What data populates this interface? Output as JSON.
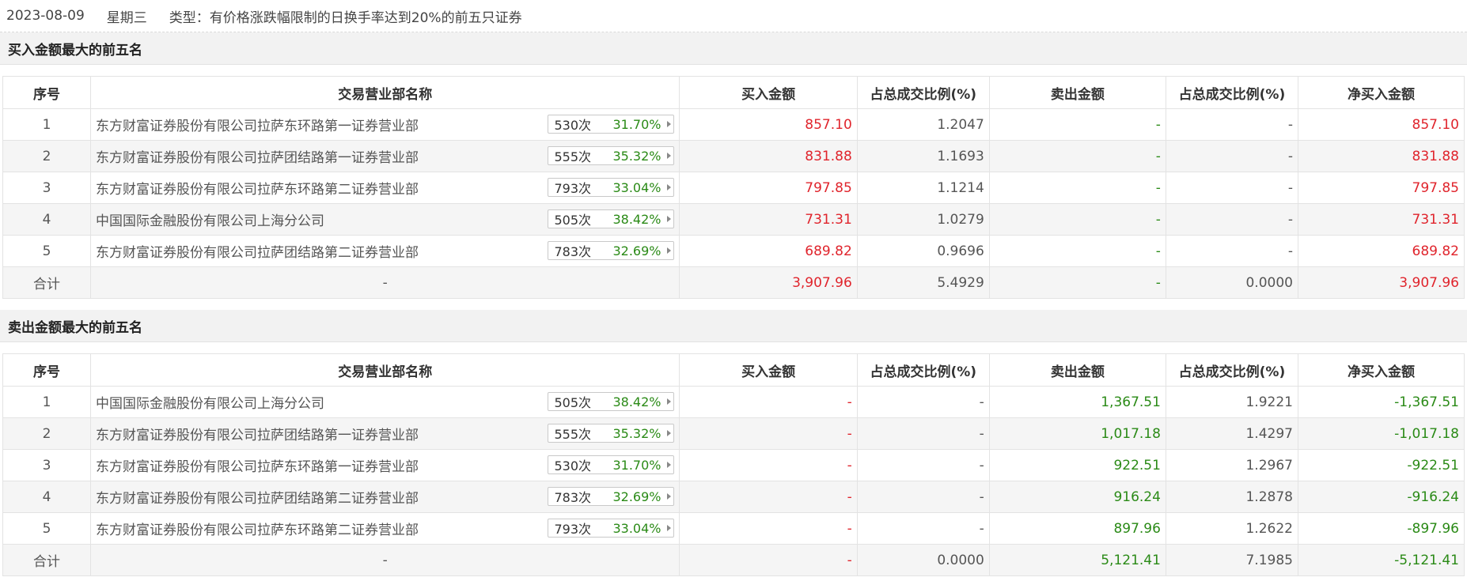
{
  "header": {
    "date": "2023-08-09",
    "weekday": "星期三",
    "type_label": "类型：有价格涨跌幅限制的日换手率达到20%的前五只证券"
  },
  "columns": [
    "序号",
    "交易营业部名称",
    "买入金额",
    "占总成交比例(%)",
    "卖出金额",
    "占总成交比例(%)",
    "净买入金额"
  ],
  "buy_section": {
    "title": "买入金额最大的前五名",
    "rows": [
      {
        "idx": "1",
        "name": "东方财富证券股份有限公司拉萨东环路第一证券营业部",
        "times": "530次",
        "pct": "31.70%",
        "buy": "857.10",
        "buy_ratio": "1.2047",
        "sell": "-",
        "sell_ratio": "-",
        "net": "857.10"
      },
      {
        "idx": "2",
        "name": "东方财富证券股份有限公司拉萨团结路第一证券营业部",
        "times": "555次",
        "pct": "35.32%",
        "buy": "831.88",
        "buy_ratio": "1.1693",
        "sell": "-",
        "sell_ratio": "-",
        "net": "831.88"
      },
      {
        "idx": "3",
        "name": "东方财富证券股份有限公司拉萨东环路第二证券营业部",
        "times": "793次",
        "pct": "33.04%",
        "buy": "797.85",
        "buy_ratio": "1.1214",
        "sell": "-",
        "sell_ratio": "-",
        "net": "797.85"
      },
      {
        "idx": "4",
        "name": "中国国际金融股份有限公司上海分公司",
        "times": "505次",
        "pct": "38.42%",
        "buy": "731.31",
        "buy_ratio": "1.0279",
        "sell": "-",
        "sell_ratio": "-",
        "net": "731.31"
      },
      {
        "idx": "5",
        "name": "东方财富证券股份有限公司拉萨团结路第二证券营业部",
        "times": "783次",
        "pct": "32.69%",
        "buy": "689.82",
        "buy_ratio": "0.9696",
        "sell": "-",
        "sell_ratio": "-",
        "net": "689.82"
      }
    ],
    "total": {
      "label": "合计",
      "name": "-",
      "buy": "3,907.96",
      "buy_ratio": "5.4929",
      "sell": "-",
      "sell_ratio": "0.0000",
      "net": "3,907.96"
    }
  },
  "sell_section": {
    "title": "卖出金额最大的前五名",
    "rows": [
      {
        "idx": "1",
        "name": "中国国际金融股份有限公司上海分公司",
        "times": "505次",
        "pct": "38.42%",
        "buy": "-",
        "buy_ratio": "-",
        "sell": "1,367.51",
        "sell_ratio": "1.9221",
        "net": "-1,367.51"
      },
      {
        "idx": "2",
        "name": "东方财富证券股份有限公司拉萨团结路第一证券营业部",
        "times": "555次",
        "pct": "35.32%",
        "buy": "-",
        "buy_ratio": "-",
        "sell": "1,017.18",
        "sell_ratio": "1.4297",
        "net": "-1,017.18"
      },
      {
        "idx": "3",
        "name": "东方财富证券股份有限公司拉萨东环路第一证券营业部",
        "times": "530次",
        "pct": "31.70%",
        "buy": "-",
        "buy_ratio": "-",
        "sell": "922.51",
        "sell_ratio": "1.2967",
        "net": "-922.51"
      },
      {
        "idx": "4",
        "name": "东方财富证券股份有限公司拉萨团结路第二证券营业部",
        "times": "783次",
        "pct": "32.69%",
        "buy": "-",
        "buy_ratio": "-",
        "sell": "916.24",
        "sell_ratio": "1.2878",
        "net": "-916.24"
      },
      {
        "idx": "5",
        "name": "东方财富证券股份有限公司拉萨东环路第二证券营业部",
        "times": "793次",
        "pct": "33.04%",
        "buy": "-",
        "buy_ratio": "-",
        "sell": "897.96",
        "sell_ratio": "1.2622",
        "net": "-897.96"
      }
    ],
    "total": {
      "label": "合计",
      "name": "-",
      "buy": "-",
      "buy_ratio": "0.0000",
      "sell": "5,121.41",
      "sell_ratio": "7.1985",
      "net": "-5,121.41"
    }
  },
  "colors": {
    "up": "#e0242c",
    "down": "#2a8a16"
  }
}
